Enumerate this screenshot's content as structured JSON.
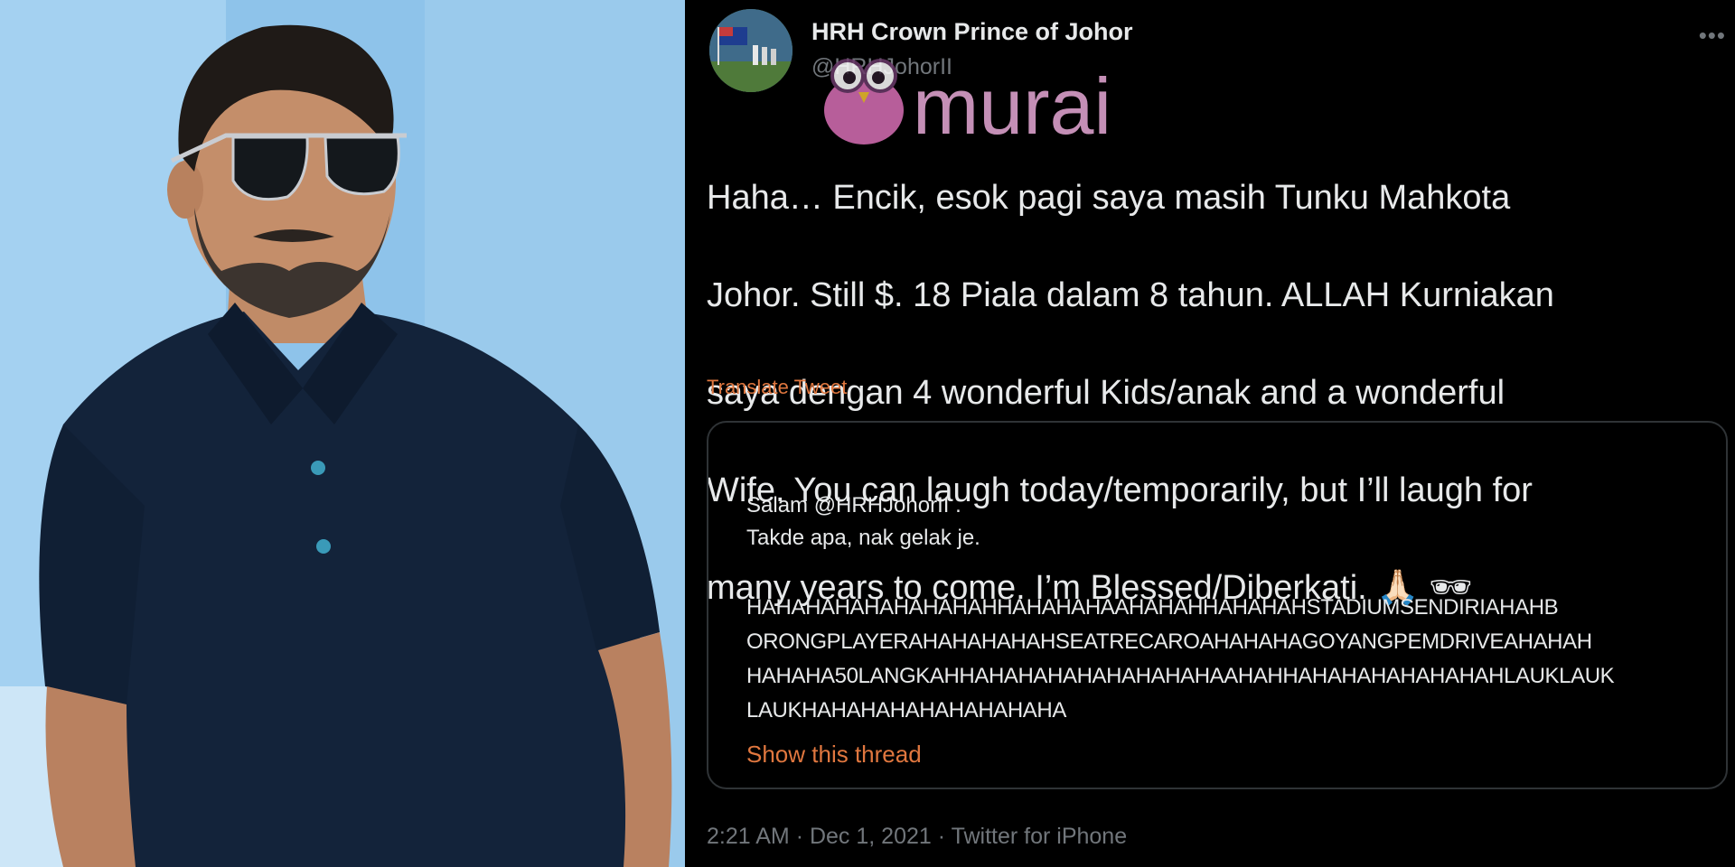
{
  "tweet": {
    "display_name": "HRH Crown Prince of Johor",
    "handle": "@HRHJohorII",
    "more_icon": "more-dots-icon",
    "body_lines": [
      "Haha… Encik, esok pagi saya masih Tunku Mahkota",
      "Johor. Still $. 18 Piala dalam 8 tahun. ALLAH Kurniakan",
      "saya dengan 4 wonderful Kids/anak and a wonderful",
      "Wife. You can laugh today/temporarily, but I’ll laugh for",
      "many years to come. I’m Blessed/Diberkati. 🙏🏻 🕶"
    ],
    "translate_label": "Translate Tweet",
    "meta": {
      "time": "2:21 AM",
      "date": "Dec 1, 2021",
      "source": "Twitter for iPhone",
      "separator": "·"
    },
    "accent_color": "#e0773f"
  },
  "quote": {
    "line1": "Salam @HRHJohorII .",
    "line2": "Takde apa, nak gelak je.",
    "caps_lines": [
      "HAHAHAHAHAHAHAHAHHAHAHAHAAHAHAHHAHAHAHSTADIUMSENDIRIAHAHB",
      "ORONGPLAYERAHAHAHAHAHSEATRECAROAHAHAHAGOYANGPEMDRIVEAHAHAH",
      "HAHAHA50LANGKAHHAHAHAHAHAHAHAHAHAAHAHHAHAHAHAHAHAHAHLAUKLAUK",
      "LAUKHAHAHAHAHAHAHAHAHA"
    ],
    "show_thread_label": "Show this thread"
  },
  "watermark": {
    "text": "murai",
    "icon": "owl-logo-icon"
  }
}
